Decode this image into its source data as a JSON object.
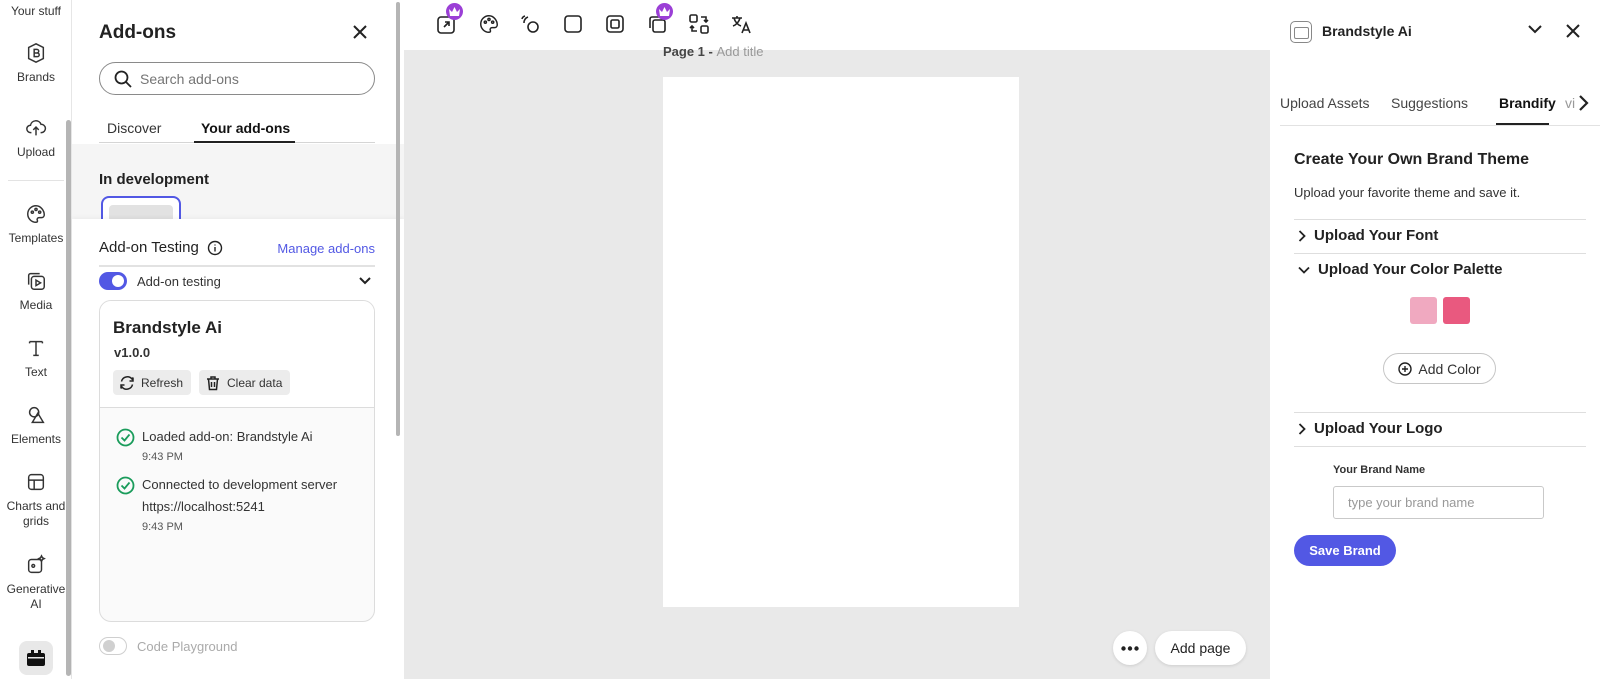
{
  "rail": {
    "top_label": "Your stuff",
    "items": [
      {
        "label": "Brands",
        "icon": "brands-icon"
      },
      {
        "label": "Upload",
        "icon": "upload-icon"
      },
      {
        "label": "Templates",
        "icon": "templates-icon"
      },
      {
        "label": "Media",
        "icon": "media-icon"
      },
      {
        "label": "Text",
        "icon": "text-icon"
      },
      {
        "label": "Elements",
        "icon": "elements-icon"
      },
      {
        "label": "Charts and grids",
        "icon": "charts-icon"
      },
      {
        "label": "Generative AI",
        "icon": "generative-ai-icon"
      }
    ]
  },
  "addons": {
    "title": "Add-ons",
    "search_placeholder": "Search add-ons",
    "tabs": [
      "Discover",
      "Your add-ons"
    ],
    "in_development": "In development",
    "testing_title": "Add-on Testing",
    "manage_link": "Manage add-ons",
    "toggle_label": "Add-on testing",
    "card": {
      "name": "Brandstyle Ai",
      "version": "v1.0.0",
      "refresh": "Refresh",
      "clear": "Clear data",
      "logs": [
        {
          "text": "Loaded add-on: Brandstyle Ai",
          "time": "9:43 PM"
        },
        {
          "text": "Connected to development server",
          "text2": "https://localhost:5241",
          "time": "9:43 PM"
        }
      ]
    },
    "code_playground": "Code Playground"
  },
  "canvas": {
    "page_label": "Page 1 -",
    "page_title_placeholder": "Add title",
    "add_page": "Add page"
  },
  "brandstyle": {
    "title": "Brandstyle Ai",
    "tabs": [
      "Upload Assets",
      "Suggestions",
      "Brandify",
      "vi"
    ],
    "heading": "Create Your Own Brand Theme",
    "subheading": "Upload your favorite theme and save it.",
    "sections": [
      "Upload Your Font",
      "Upload Your Color Palette",
      "Upload Your Logo"
    ],
    "swatches": [
      "#f0a9c0",
      "#e9597f"
    ],
    "add_color": "Add Color",
    "brand_name_label": "Your Brand Name",
    "brand_name_placeholder": "type your brand name",
    "save": "Save Brand"
  },
  "colors": {
    "accent": "#5258e4",
    "crown": "#9b3fd6",
    "success": "#1a9c5b"
  }
}
